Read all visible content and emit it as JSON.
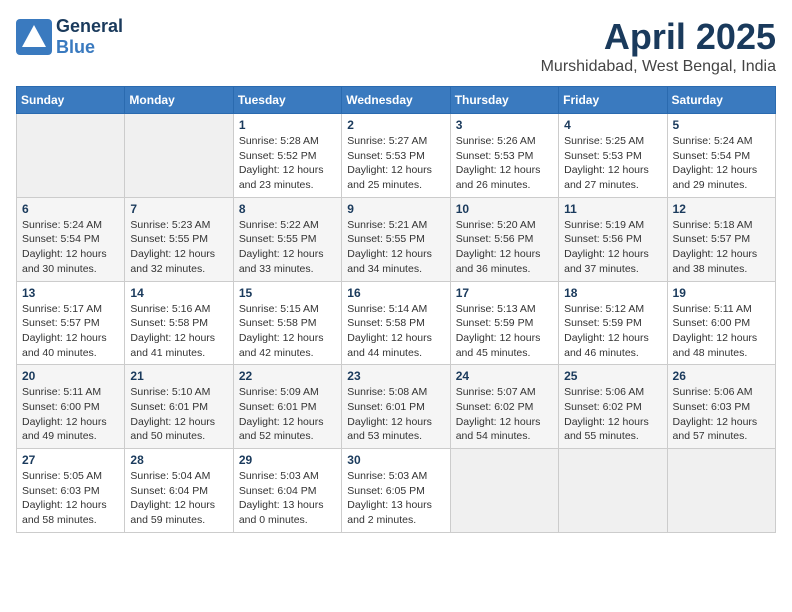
{
  "header": {
    "logo_general": "General",
    "logo_blue": "Blue",
    "title": "April 2025",
    "location": "Murshidabad, West Bengal, India"
  },
  "days_of_week": [
    "Sunday",
    "Monday",
    "Tuesday",
    "Wednesday",
    "Thursday",
    "Friday",
    "Saturday"
  ],
  "weeks": [
    [
      {
        "day": "",
        "info": ""
      },
      {
        "day": "",
        "info": ""
      },
      {
        "day": "1",
        "info": "Sunrise: 5:28 AM\nSunset: 5:52 PM\nDaylight: 12 hours\nand 23 minutes."
      },
      {
        "day": "2",
        "info": "Sunrise: 5:27 AM\nSunset: 5:53 PM\nDaylight: 12 hours\nand 25 minutes."
      },
      {
        "day": "3",
        "info": "Sunrise: 5:26 AM\nSunset: 5:53 PM\nDaylight: 12 hours\nand 26 minutes."
      },
      {
        "day": "4",
        "info": "Sunrise: 5:25 AM\nSunset: 5:53 PM\nDaylight: 12 hours\nand 27 minutes."
      },
      {
        "day": "5",
        "info": "Sunrise: 5:24 AM\nSunset: 5:54 PM\nDaylight: 12 hours\nand 29 minutes."
      }
    ],
    [
      {
        "day": "6",
        "info": "Sunrise: 5:24 AM\nSunset: 5:54 PM\nDaylight: 12 hours\nand 30 minutes."
      },
      {
        "day": "7",
        "info": "Sunrise: 5:23 AM\nSunset: 5:55 PM\nDaylight: 12 hours\nand 32 minutes."
      },
      {
        "day": "8",
        "info": "Sunrise: 5:22 AM\nSunset: 5:55 PM\nDaylight: 12 hours\nand 33 minutes."
      },
      {
        "day": "9",
        "info": "Sunrise: 5:21 AM\nSunset: 5:55 PM\nDaylight: 12 hours\nand 34 minutes."
      },
      {
        "day": "10",
        "info": "Sunrise: 5:20 AM\nSunset: 5:56 PM\nDaylight: 12 hours\nand 36 minutes."
      },
      {
        "day": "11",
        "info": "Sunrise: 5:19 AM\nSunset: 5:56 PM\nDaylight: 12 hours\nand 37 minutes."
      },
      {
        "day": "12",
        "info": "Sunrise: 5:18 AM\nSunset: 5:57 PM\nDaylight: 12 hours\nand 38 minutes."
      }
    ],
    [
      {
        "day": "13",
        "info": "Sunrise: 5:17 AM\nSunset: 5:57 PM\nDaylight: 12 hours\nand 40 minutes."
      },
      {
        "day": "14",
        "info": "Sunrise: 5:16 AM\nSunset: 5:58 PM\nDaylight: 12 hours\nand 41 minutes."
      },
      {
        "day": "15",
        "info": "Sunrise: 5:15 AM\nSunset: 5:58 PM\nDaylight: 12 hours\nand 42 minutes."
      },
      {
        "day": "16",
        "info": "Sunrise: 5:14 AM\nSunset: 5:58 PM\nDaylight: 12 hours\nand 44 minutes."
      },
      {
        "day": "17",
        "info": "Sunrise: 5:13 AM\nSunset: 5:59 PM\nDaylight: 12 hours\nand 45 minutes."
      },
      {
        "day": "18",
        "info": "Sunrise: 5:12 AM\nSunset: 5:59 PM\nDaylight: 12 hours\nand 46 minutes."
      },
      {
        "day": "19",
        "info": "Sunrise: 5:11 AM\nSunset: 6:00 PM\nDaylight: 12 hours\nand 48 minutes."
      }
    ],
    [
      {
        "day": "20",
        "info": "Sunrise: 5:11 AM\nSunset: 6:00 PM\nDaylight: 12 hours\nand 49 minutes."
      },
      {
        "day": "21",
        "info": "Sunrise: 5:10 AM\nSunset: 6:01 PM\nDaylight: 12 hours\nand 50 minutes."
      },
      {
        "day": "22",
        "info": "Sunrise: 5:09 AM\nSunset: 6:01 PM\nDaylight: 12 hours\nand 52 minutes."
      },
      {
        "day": "23",
        "info": "Sunrise: 5:08 AM\nSunset: 6:01 PM\nDaylight: 12 hours\nand 53 minutes."
      },
      {
        "day": "24",
        "info": "Sunrise: 5:07 AM\nSunset: 6:02 PM\nDaylight: 12 hours\nand 54 minutes."
      },
      {
        "day": "25",
        "info": "Sunrise: 5:06 AM\nSunset: 6:02 PM\nDaylight: 12 hours\nand 55 minutes."
      },
      {
        "day": "26",
        "info": "Sunrise: 5:06 AM\nSunset: 6:03 PM\nDaylight: 12 hours\nand 57 minutes."
      }
    ],
    [
      {
        "day": "27",
        "info": "Sunrise: 5:05 AM\nSunset: 6:03 PM\nDaylight: 12 hours\nand 58 minutes."
      },
      {
        "day": "28",
        "info": "Sunrise: 5:04 AM\nSunset: 6:04 PM\nDaylight: 12 hours\nand 59 minutes."
      },
      {
        "day": "29",
        "info": "Sunrise: 5:03 AM\nSunset: 6:04 PM\nDaylight: 13 hours\nand 0 minutes."
      },
      {
        "day": "30",
        "info": "Sunrise: 5:03 AM\nSunset: 6:05 PM\nDaylight: 13 hours\nand 2 minutes."
      },
      {
        "day": "",
        "info": ""
      },
      {
        "day": "",
        "info": ""
      },
      {
        "day": "",
        "info": ""
      }
    ]
  ]
}
